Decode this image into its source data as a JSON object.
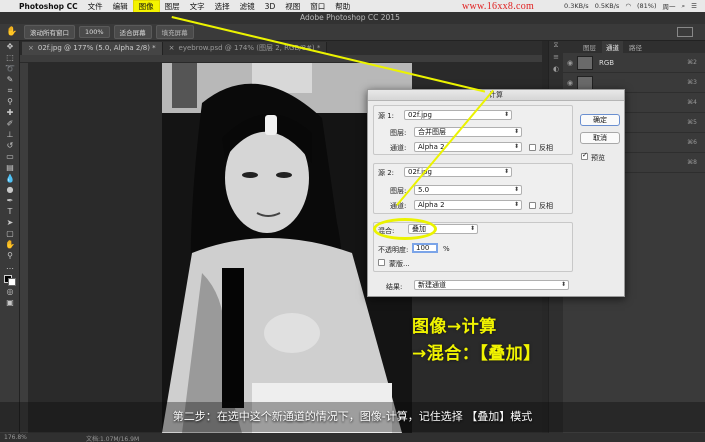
{
  "menubar": {
    "app": "Photoshop CC",
    "items": [
      "文件",
      "编辑",
      "图像",
      "图层",
      "文字",
      "选择",
      "滤镜",
      "3D",
      "视图",
      "窗口",
      "帮助"
    ],
    "highlighted": "图像",
    "window_title": "Adobe Photoshop CC 2015",
    "watermark": "www.16xx8.com",
    "net_up": "0.3KB/s",
    "net_down": "0.5KB/s",
    "battery": "(81%)",
    "time": "周一"
  },
  "options_bar": {
    "buttons": [
      "滚动所有窗口",
      "100%",
      "适合屏幕",
      "填充屏幕"
    ]
  },
  "tabs": [
    {
      "label": "02f.jpg @ 177% (5.0, Alpha 2/8) *"
    },
    {
      "label": "eyebrow.psd @ 174% (图层 2, RGB/8#) *"
    }
  ],
  "right_panel": {
    "tabs": [
      "图层",
      "通道",
      "路径"
    ],
    "active_tab": "通道",
    "rows": [
      {
        "name": "RGB",
        "shortcut": "⌘2"
      },
      {
        "name": "",
        "shortcut": "⌘3"
      },
      {
        "name": "",
        "shortcut": "⌘4"
      },
      {
        "name": "",
        "shortcut": "⌘5"
      },
      {
        "name": "",
        "shortcut": "⌘6"
      },
      {
        "name": "",
        "shortcut": "⌘7"
      },
      {
        "name": "",
        "shortcut": "⌘8"
      }
    ]
  },
  "dialog": {
    "title": "计算",
    "source1_label": "源 1:",
    "source1_value": "02f.jpg",
    "layer_label": "图层:",
    "layer1_value": "合并图层",
    "channel_label": "通道:",
    "channel1_value": "Alpha 2",
    "invert_label": "反相",
    "source2_label": "源 2:",
    "source2_value": "02f.jpg",
    "layer2_value": "5.0",
    "channel2_value": "Alpha 2",
    "blend_label": "混合:",
    "blend_value": "叠加",
    "opacity_label": "不透明度:",
    "opacity_value": "100",
    "opacity_unit": "%",
    "mask_label": "蒙版...",
    "result_label": "结果:",
    "result_value": "新建通道",
    "ok_label": "确定",
    "cancel_label": "取消",
    "preview_label": "预览",
    "preview_checked": true
  },
  "overlay": {
    "caption_line1": "图像→计算",
    "caption_line2": "→混合：【叠加】",
    "subtitle": "第二步：在选中这个新通道的情况下，图像-计算，记住选择 【叠加】模式"
  },
  "statusbar": {
    "zoom": "176.8%",
    "doc": "文档:1.07M/16.9M"
  },
  "colors": {
    "highlight_yellow": "#ebf300",
    "caption_yellow": "#f1f400",
    "watermark_red": "#e02020"
  }
}
